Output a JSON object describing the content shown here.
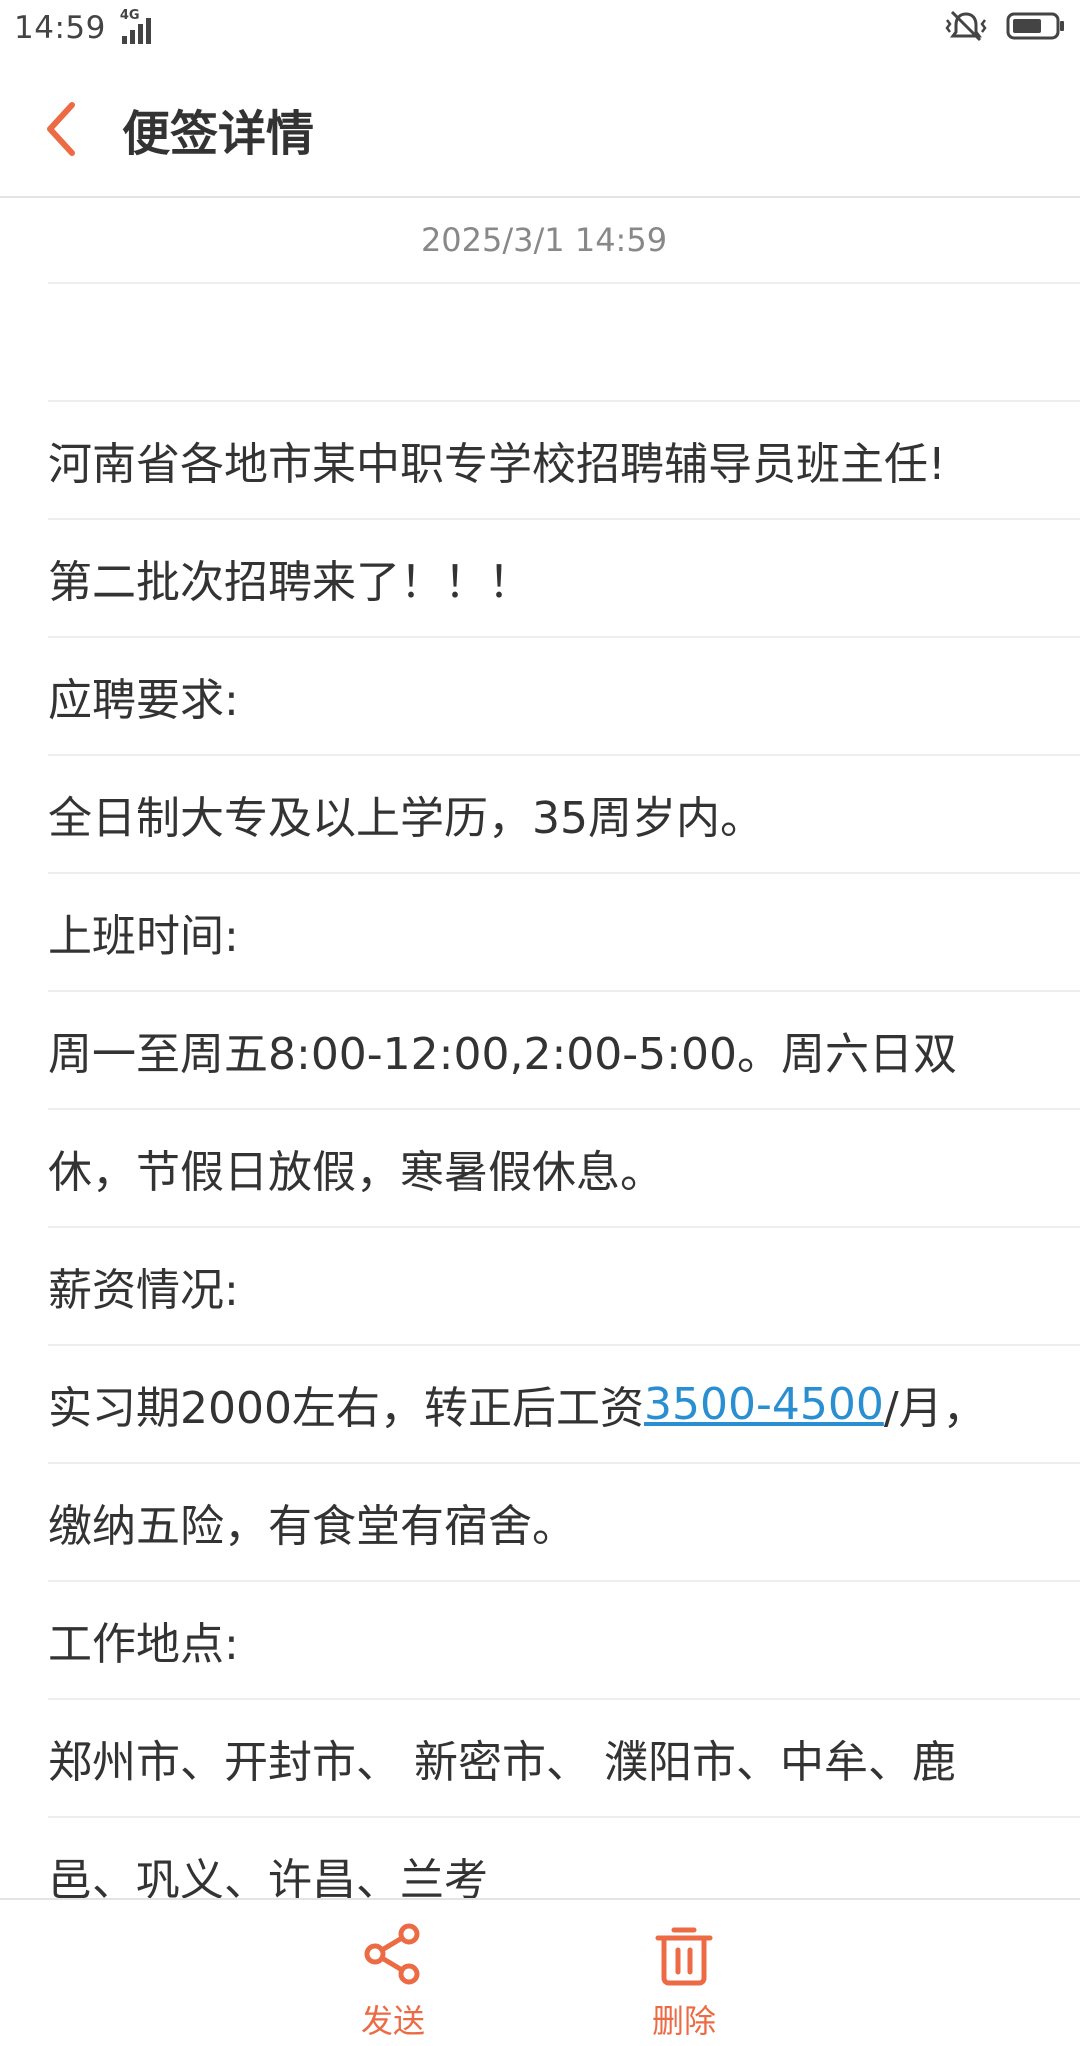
{
  "status_bar": {
    "time": "14:59",
    "network": "4G",
    "icons": [
      "signal-icon",
      "mute-vibrate-icon",
      "battery-icon"
    ]
  },
  "header": {
    "title": "便签详情",
    "back_icon": "chevron-left-icon"
  },
  "note": {
    "date": "2025/3/1 14:59",
    "lines": [
      "",
      "河南省各地市某中职专学校招聘辅导员班主任!",
      "第二批次招聘来了！！！",
      "应聘要求:",
      "全日制大专及以上学历，35周岁内。",
      "上班时间:",
      "周一至周五8:00-12:00,2:00-5:00。周六日双",
      "休，节假日放假，寒暑假休息。",
      "薪资情况:",
      {
        "before": "实习期2000左右，转正后工资",
        "link": "3500-4500",
        "after": "/月，"
      },
      "缴纳五险，有食堂有宿舍。",
      "工作地点:",
      "郑州市、开封市、 新密市、 濮阳市、中牟、鹿",
      "邑、巩义、许昌、兰考"
    ]
  },
  "bottom_bar": {
    "send_label": "发送",
    "delete_label": "删除",
    "send_icon": "share-icon",
    "delete_icon": "trash-icon"
  },
  "colors": {
    "accent": "#ec6b45",
    "link": "#2a8fd0",
    "text": "#333333",
    "muted": "#888888",
    "divider": "#eeeeee"
  }
}
